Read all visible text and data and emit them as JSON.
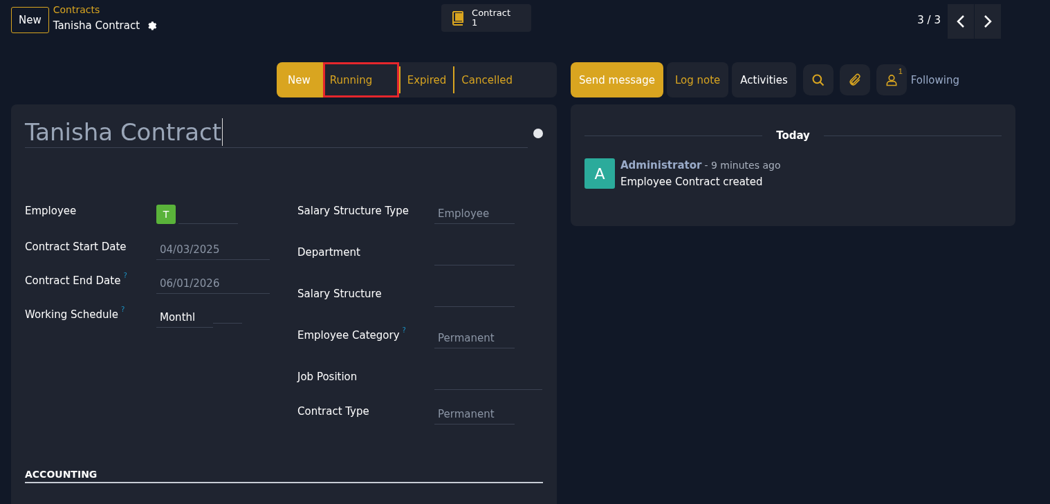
{
  "header": {
    "new_button": "New",
    "breadcrumb": "Contracts",
    "record_title": "Tanisha Contract",
    "smart_button": {
      "label": "Contract",
      "count": "1"
    },
    "pager": "3 / 3"
  },
  "stages": [
    {
      "label": "New",
      "selected": true,
      "highlighted": false
    },
    {
      "label": "Running",
      "selected": false,
      "highlighted": true
    },
    {
      "label": "Expired",
      "selected": false,
      "highlighted": false
    },
    {
      "label": "Cancelled",
      "selected": false,
      "highlighted": false
    }
  ],
  "chatter_buttons": [
    {
      "kind": "primary",
      "label": "Send message"
    },
    {
      "kind": "accent",
      "label": "Log note"
    },
    {
      "kind": "plain",
      "label": "Activities"
    }
  ],
  "followers": {
    "count": "1",
    "label": "Following"
  },
  "form": {
    "name": "Tanisha Contract",
    "left_fields": [
      {
        "label": "Employee",
        "kind": "avatar",
        "avatar": "T"
      },
      {
        "label": "Contract Start Date",
        "kind": "text",
        "value": "04/03/2025",
        "readonly": true
      },
      {
        "label": "Contract End Date",
        "kind": "text",
        "value": "06/01/2026",
        "help": "?",
        "readonly": true
      },
      {
        "label": "Working Schedule",
        "kind": "short",
        "value": "Monthl",
        "help": "?",
        "readonly": false
      }
    ],
    "right_fields": [
      {
        "label": "Salary Structure Type",
        "value": "Employee",
        "wide": false
      },
      {
        "label": "Department",
        "wide": false
      },
      {
        "label": "Salary Structure",
        "wide": false
      },
      {
        "label": "Employee Category",
        "value": "Permanent",
        "help": "?",
        "wide": false
      },
      {
        "label": "Job Position",
        "wide": true
      },
      {
        "label": "Contract Type",
        "value": "Permanent",
        "wide": false
      }
    ],
    "section": "ACCOUNTING"
  },
  "chatter": {
    "date": "Today",
    "messages": [
      {
        "avatar": "A",
        "author": "Administrator",
        "time": "- 9 minutes ago",
        "body": "Employee Contract created"
      }
    ]
  }
}
